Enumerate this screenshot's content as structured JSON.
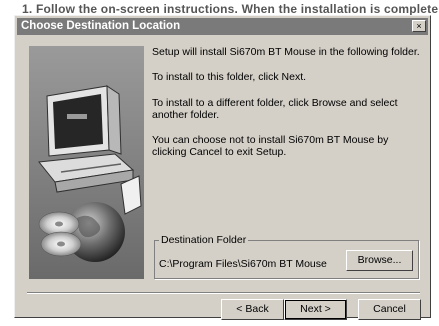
{
  "page_header": "1. Follow the on-screen instructions. When the installation is complete",
  "dialog": {
    "title": "Choose Destination Location",
    "close_label": "×"
  },
  "messages": [
    "Setup will install Si670m BT Mouse in the following folder.",
    "To install to this folder, click Next.",
    "To install to a different folder, click Browse and select another folder.",
    "You can choose not to install Si670m BT Mouse by clicking Cancel to exit Setup."
  ],
  "destination": {
    "group_label": "Destination Folder",
    "path": "C:\\Program Files\\Si670m BT Mouse",
    "browse_label": "Browse..."
  },
  "buttons": {
    "back": "< Back",
    "next": "Next >",
    "cancel": "Cancel"
  },
  "colors": {
    "dialog_bg": "#d4d0c8",
    "titlebar": "#7a7a7a"
  }
}
